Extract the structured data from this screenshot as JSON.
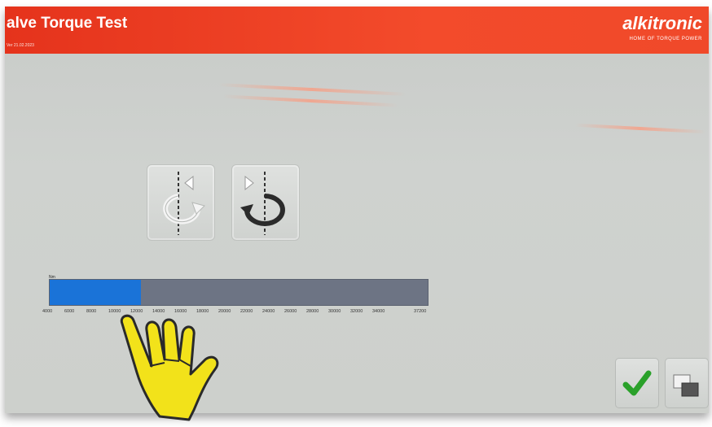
{
  "header": {
    "title": "alve Torque Test",
    "subtitle": "Ver 21.02.2023",
    "brand": "alkitronic",
    "tagline": "HOME OF TORQUE POWER"
  },
  "direction_buttons": [
    {
      "label": "tighten",
      "icon": "rotate-clockwise-icon"
    },
    {
      "label": "loosen",
      "icon": "rotate-counterclockwise-icon"
    }
  ],
  "torque_slider": {
    "unit": "Nm",
    "min": 4000,
    "max": 37200,
    "value": 12000,
    "fill_color": "#1a73d8",
    "track_color": "#6d7484",
    "ticks": [
      "4000",
      "6000",
      "8000",
      "10000",
      "12000",
      "14000",
      "16000",
      "18000",
      "20000",
      "22000",
      "24000",
      "26000",
      "28000",
      "30000",
      "32000",
      "34000",
      "37200"
    ]
  },
  "actions": {
    "confirm_icon": "checkmark-icon",
    "window_icon": "window-switch-icon",
    "confirm_color": "#2aa12a"
  },
  "colors": {
    "header": "#f0492a",
    "background": "#cdd0cc"
  }
}
